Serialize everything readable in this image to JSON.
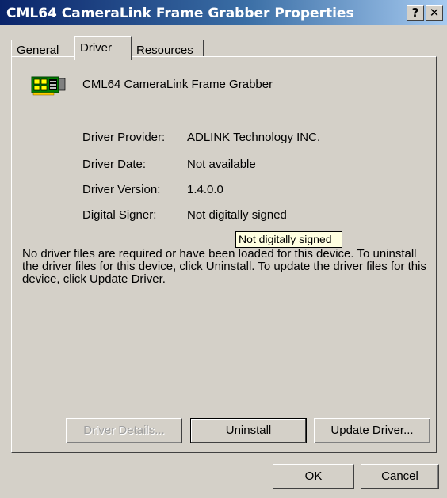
{
  "window": {
    "title": "CML64 CameraLink Frame Grabber Properties",
    "help_label": "?",
    "close_label": "✕"
  },
  "tabs": [
    {
      "label": "General"
    },
    {
      "label": "Driver"
    },
    {
      "label": "Resources"
    }
  ],
  "device": {
    "icon": "circuit-board-icon",
    "name": "CML64 CameraLink Frame Grabber"
  },
  "driver_info": {
    "provider_label": "Driver Provider:",
    "provider_value": "ADLINK Technology INC.",
    "date_label": "Driver Date:",
    "date_value": "Not available",
    "version_label": "Driver Version:",
    "version_value": "1.4.0.0",
    "signer_label": "Digital Signer:",
    "signer_value": "Not digitally signed"
  },
  "tooltip": "Not digitally signed",
  "description": "No driver files are required or have been loaded for this device. To uninstall the driver files for this device, click Uninstall. To update the driver files for this device, click Update Driver.",
  "buttons": {
    "details": "Driver Details...",
    "uninstall": "Uninstall",
    "update": "Update Driver...",
    "ok": "OK",
    "cancel": "Cancel"
  }
}
